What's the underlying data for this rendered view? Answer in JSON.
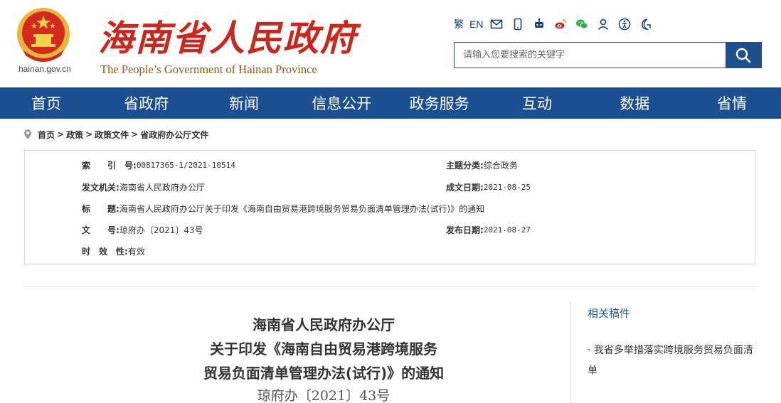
{
  "header": {
    "domain": "hainan.gov.cn",
    "site_title": "海南省人民政府",
    "site_subtitle": "The People’s Government  of Hainan Province",
    "tools": {
      "traditional": "繁",
      "english": "EN"
    },
    "search": {
      "placeholder": "请输入您要搜索的关键字"
    },
    "colors": {
      "brand_red": "#c8281e",
      "nav_blue": "#1c4f92"
    }
  },
  "nav": {
    "items": [
      "首页",
      "省政府",
      "新闻",
      "信息公开",
      "政务服务",
      "互动",
      "数据",
      "省情"
    ]
  },
  "breadcrumb": {
    "items": [
      "首页",
      "政策",
      "政策文件",
      "省政府办公厅文件"
    ],
    "separator": ">"
  },
  "info": {
    "index_label": "索　　引　号:",
    "index_value": "00817365-1/2021-10514",
    "category_label": "主题分类:",
    "category_value": "综合政务",
    "issuer_label": "发文机关:",
    "issuer_value": "海南省人民政府办公厅",
    "created_label": "成文日期:",
    "created_value": "2021-08-25",
    "title_label": "标　　题:",
    "title_value": "海南省人民政府办公厅关于印发《海南自由贸易港跨境服务贸易负面清单管理办法(试行)》的通知",
    "docno_label": "文　　号:",
    "docno_value": "琼府办〔2021〕43号",
    "published_label": "发布日期:",
    "published_value": "2021-08-27",
    "validity_label": "时　效　性:",
    "validity_value": "有效"
  },
  "article": {
    "title_line1": "海南省人民政府办公厅",
    "title_line2": "关于印发《海南自由贸易港跨境服务",
    "title_line3": "贸易负面清单管理办法(试行)》的通知",
    "doc_number": "琼府办〔2021〕43号"
  },
  "related": {
    "heading": "相关稿件",
    "items": [
      "· 我省多举措落实跨境服务贸易负面清单"
    ]
  }
}
